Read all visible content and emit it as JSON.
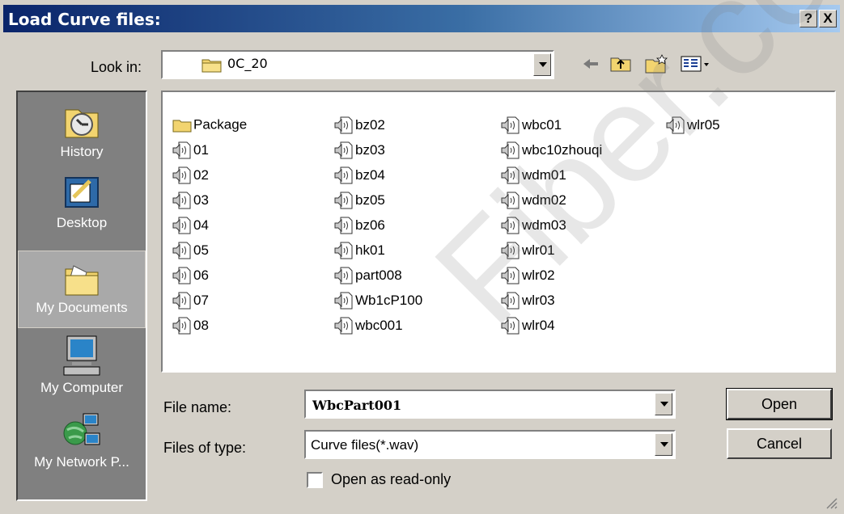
{
  "window": {
    "title": "Load Curve files:",
    "help_label": "?",
    "close_label": "X"
  },
  "lookin": {
    "label": "Look in:",
    "value": "0C_20"
  },
  "places": [
    {
      "label": "History",
      "icon": "history-icon"
    },
    {
      "label": "Desktop",
      "icon": "desktop-icon"
    },
    {
      "label": "My Documents",
      "icon": "my-documents-icon"
    },
    {
      "label": "My Computer",
      "icon": "my-computer-icon"
    },
    {
      "label": "My Network P...",
      "icon": "my-network-places-icon"
    }
  ],
  "files": {
    "col1": [
      "Package",
      "01",
      "02",
      "03",
      "04",
      "05",
      "06",
      "07",
      "08"
    ],
    "col2": [
      "bz02",
      "bz03",
      "bz04",
      "bz05",
      "bz06",
      "hk01",
      "part008",
      "Wb1cP100",
      "wbc001"
    ],
    "col3": [
      "wbc01",
      "wbc10zhouqi",
      "wdm01",
      "wdm02",
      "wdm03",
      "wlr01",
      "wlr02",
      "wlr03",
      "wlr04"
    ],
    "col4": [
      "wlr05"
    ]
  },
  "filename": {
    "label": "File name:",
    "value": "WbcPart001"
  },
  "filetype": {
    "label": "Files of type:",
    "value": "Curve files(*.wav)"
  },
  "readonly": {
    "label": "Open as read-only",
    "checked": false
  },
  "buttons": {
    "open": "Open",
    "cancel": "Cancel"
  },
  "watermark": "Fiber.com",
  "colors": {
    "titlebar_start": "#0a246a",
    "titlebar_end": "#a6caf0",
    "dialog_bg": "#d4d0c8",
    "places_bg": "#808080"
  }
}
